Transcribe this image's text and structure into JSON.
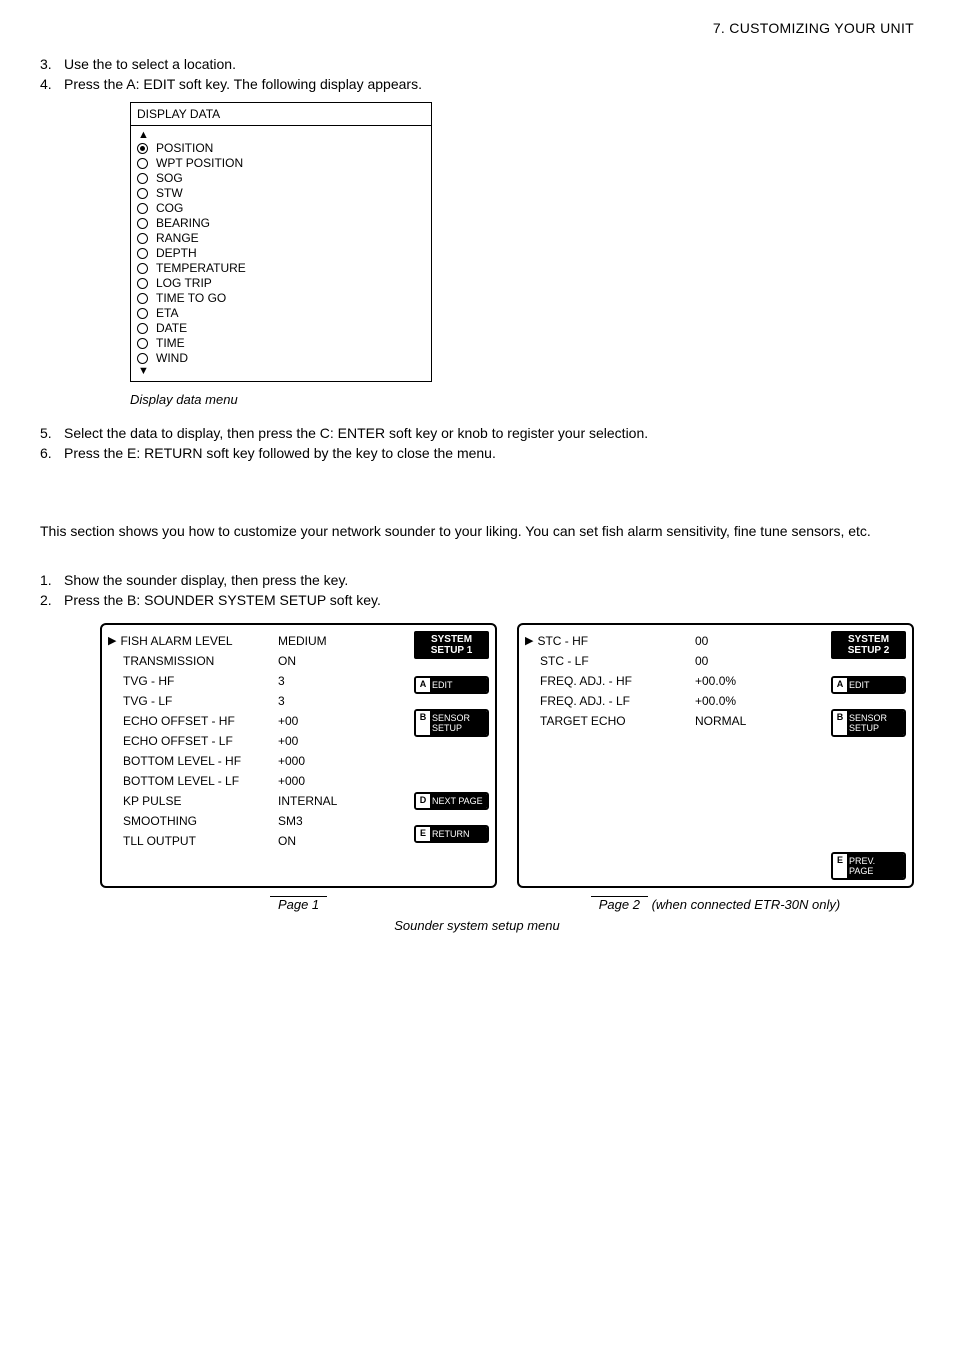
{
  "header": {
    "section_title": "7.  CUSTOMIZING YOUR UNIT"
  },
  "steps_a": [
    {
      "num": "3.",
      "text": "Use the                     to select a location."
    },
    {
      "num": "4.",
      "text": "Press the A: EDIT soft key. The following display appears."
    }
  ],
  "display_box": {
    "title": "DISPLAY DATA",
    "arrow_up": "▲",
    "arrow_down": "▼",
    "items": [
      {
        "label": "POSITION",
        "selected": true
      },
      {
        "label": "WPT POSITION",
        "selected": false
      },
      {
        "label": "SOG",
        "selected": false
      },
      {
        "label": "STW",
        "selected": false
      },
      {
        "label": "COG",
        "selected": false
      },
      {
        "label": "BEARING",
        "selected": false
      },
      {
        "label": "RANGE",
        "selected": false
      },
      {
        "label": "DEPTH",
        "selected": false
      },
      {
        "label": "TEMPERATURE",
        "selected": false
      },
      {
        "label": "LOG TRIP",
        "selected": false
      },
      {
        "label": "TIME TO GO",
        "selected": false
      },
      {
        "label": "ETA",
        "selected": false
      },
      {
        "label": "DATE",
        "selected": false
      },
      {
        "label": "TIME",
        "selected": false
      },
      {
        "label": "WIND",
        "selected": false
      }
    ]
  },
  "fig1_caption": "Display data menu",
  "steps_b": [
    {
      "num": "5.",
      "text": "Select the data to display, then press the C: ENTER soft key or               knob to register your selection."
    },
    {
      "num": "6.",
      "text": "Press the E: RETURN soft key followed by the               key to close the menu."
    }
  ],
  "paragraph": "This section shows you how to customize your network sounder to your liking. You can set fish alarm sensitivity, fine tune sensors, etc.",
  "steps_c": [
    {
      "num": "1.",
      "text": "Show the sounder display, then press the               key."
    },
    {
      "num": "2.",
      "text": "Press the B: SOUNDER SYSTEM SETUP soft key."
    }
  ],
  "menu1": {
    "side_header_line1": "SYSTEM",
    "side_header_line2": "SETUP 1",
    "side_buttons": [
      {
        "letter": "A",
        "text": "EDIT"
      },
      {
        "letter": "B",
        "text": "SENSOR SETUP"
      },
      {
        "letter": "D",
        "text": "NEXT PAGE"
      },
      {
        "letter": "E",
        "text": "RETURN"
      }
    ],
    "rows": [
      {
        "label": "FISH ALARM LEVEL",
        "value": "MEDIUM",
        "caret": true
      },
      {
        "label": "TRANSMISSION",
        "value": "ON"
      },
      {
        "label": "TVG - HF",
        "value": "3"
      },
      {
        "label": "TVG - LF",
        "value": "3"
      },
      {
        "label": "ECHO OFFSET - HF",
        "value": "+00"
      },
      {
        "label": "ECHO OFFSET - LF",
        "value": "+00"
      },
      {
        "label": "BOTTOM LEVEL - HF",
        "value": "+000"
      },
      {
        "label": "BOTTOM LEVEL - LF",
        "value": "+000"
      },
      {
        "label": "KP PULSE",
        "value": "INTERNAL"
      },
      {
        "label": "SMOOTHING",
        "value": "SM3"
      },
      {
        "label": "TLL OUTPUT",
        "value": "ON"
      }
    ]
  },
  "menu2": {
    "side_header_line1": "SYSTEM",
    "side_header_line2": "SETUP 2",
    "side_buttons": [
      {
        "letter": "A",
        "text": "EDIT"
      },
      {
        "letter": "B",
        "text": "SENSOR SETUP"
      },
      {
        "letter": "E",
        "text": "PREV. PAGE"
      }
    ],
    "rows": [
      {
        "label": "STC - HF",
        "value": "00",
        "caret": true
      },
      {
        "label": "STC - LF",
        "value": "00"
      },
      {
        "label": "FREQ. ADJ. - HF",
        "value": "+00.0%"
      },
      {
        "label": "FREQ. ADJ. - LF",
        "value": "+00.0%"
      },
      {
        "label": "TARGET ECHO",
        "value": "NORMAL"
      }
    ]
  },
  "pages": {
    "page1": "Page 1",
    "page2_prefix": "Page 2",
    "page2_suffix": " (when connected ETR-30N only)"
  },
  "fig2_caption": "Sounder system setup menu"
}
